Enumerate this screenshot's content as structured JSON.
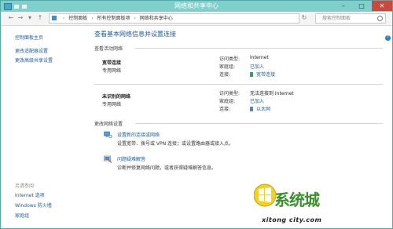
{
  "window": {
    "title": "网络和共享中心",
    "minimize": "–",
    "maximize": "□",
    "close": "✕"
  },
  "toolbar": {
    "back": "←",
    "forward": "→",
    "history": "▾",
    "up": "↑",
    "breadcrumb": [
      "控制面板",
      "所有控制面板项",
      "网络和共享中心"
    ],
    "breadcrumb_sep": "›",
    "refresh": "↻",
    "search_placeholder": "搜索控制面板"
  },
  "sidebar": {
    "links": [
      "控制面板主页",
      "更改适配器设置",
      "更改高级共享设置"
    ],
    "see_also_heading": "另请参阅",
    "see_also": [
      "Internet 选项",
      "Windows 防火墙",
      "家庭组"
    ]
  },
  "main": {
    "title": "查看基本网络信息并设置连接",
    "active_networks_label": "查看活动网络",
    "networks": [
      {
        "name": "宽带连接",
        "type": "专用网络",
        "access_type_key": "访问类型:",
        "access_type_val": "Internet",
        "homegroup_key": "家庭组:",
        "homegroup_val": "已加入",
        "connection_key": "连接:",
        "connection_val": "宽带连接"
      },
      {
        "name": "未识别的网络",
        "type": "专用网络",
        "access_type_key": "访问类型:",
        "access_type_val": "无法连接到 Internet",
        "homegroup_key": "家庭组:",
        "homegroup_val": "已加入",
        "connection_key": "连接:",
        "connection_val": "以太网"
      }
    ],
    "change_settings_label": "更改网络设置",
    "tasks": [
      {
        "title": "设置新的连接或网络",
        "desc": "设置宽带、拨号或 VPN 连接；或设置路由器或接入点。"
      },
      {
        "title": "问题疑难解答",
        "desc": "诊断并修复网络问题，或者获得疑难解答信息。"
      }
    ]
  },
  "watermark": {
    "text": "系统城",
    "url": "xitong city.com"
  }
}
